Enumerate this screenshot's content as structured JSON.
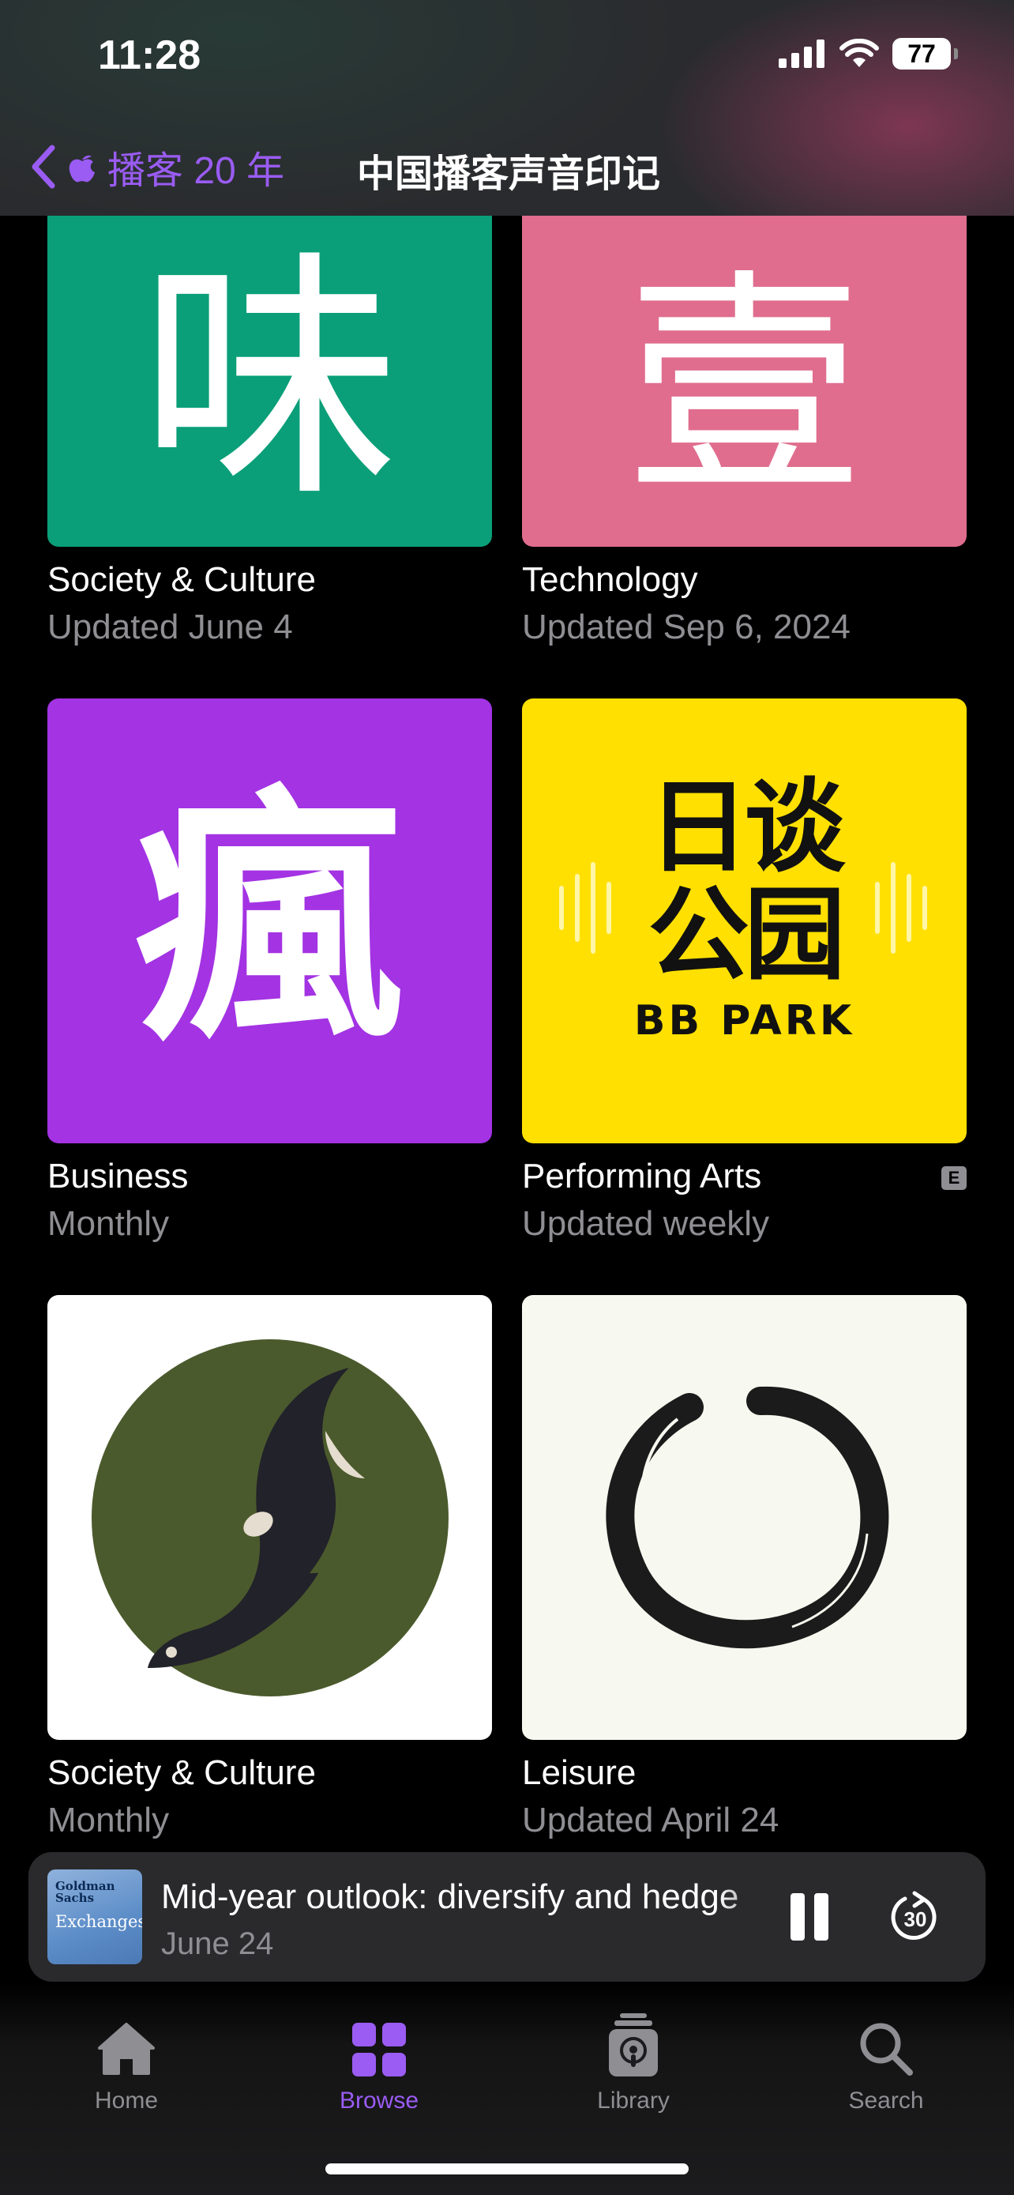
{
  "status_bar": {
    "time": "11:28",
    "battery": "77"
  },
  "nav": {
    "back_label": "播客 20 年",
    "title": "中国播客声音印记"
  },
  "cards": [
    {
      "category": "Society & Culture",
      "updated": "Updated June 4",
      "art_text": "味",
      "art_color": "#0a9f78"
    },
    {
      "category": "Technology",
      "updated": "Updated Sep 6, 2024",
      "art_text": "壹",
      "art_color": "#e06d8e"
    },
    {
      "category": "Business",
      "updated": "Monthly",
      "art_text": "瘋",
      "art_color": "#a333e3"
    },
    {
      "category": "Performing Arts",
      "updated": "Updated weekly",
      "art_text": "日谈公园",
      "art_subtext": "BB PARK",
      "art_color": "#ffe000",
      "explicit": "E"
    },
    {
      "category": "Society & Culture",
      "updated": "Monthly",
      "art_color": "#ffffff",
      "icon": "swallow-logo"
    },
    {
      "category": "Leisure",
      "updated": "Updated April 24",
      "art_color": "#f7f8ef",
      "icon": "ink-circle-logo"
    }
  ],
  "player": {
    "art_line1": "Goldman Sachs",
    "art_line2": "Exchanges",
    "title": "Mid-year outlook: diversify and hedge",
    "date": "June 24",
    "skip_seconds": "30"
  },
  "tabs": [
    {
      "label": "Home"
    },
    {
      "label": "Browse"
    },
    {
      "label": "Library"
    },
    {
      "label": "Search"
    }
  ],
  "colors": {
    "accent": "#9a5cf3",
    "secondary_text": "#8e8e93"
  }
}
